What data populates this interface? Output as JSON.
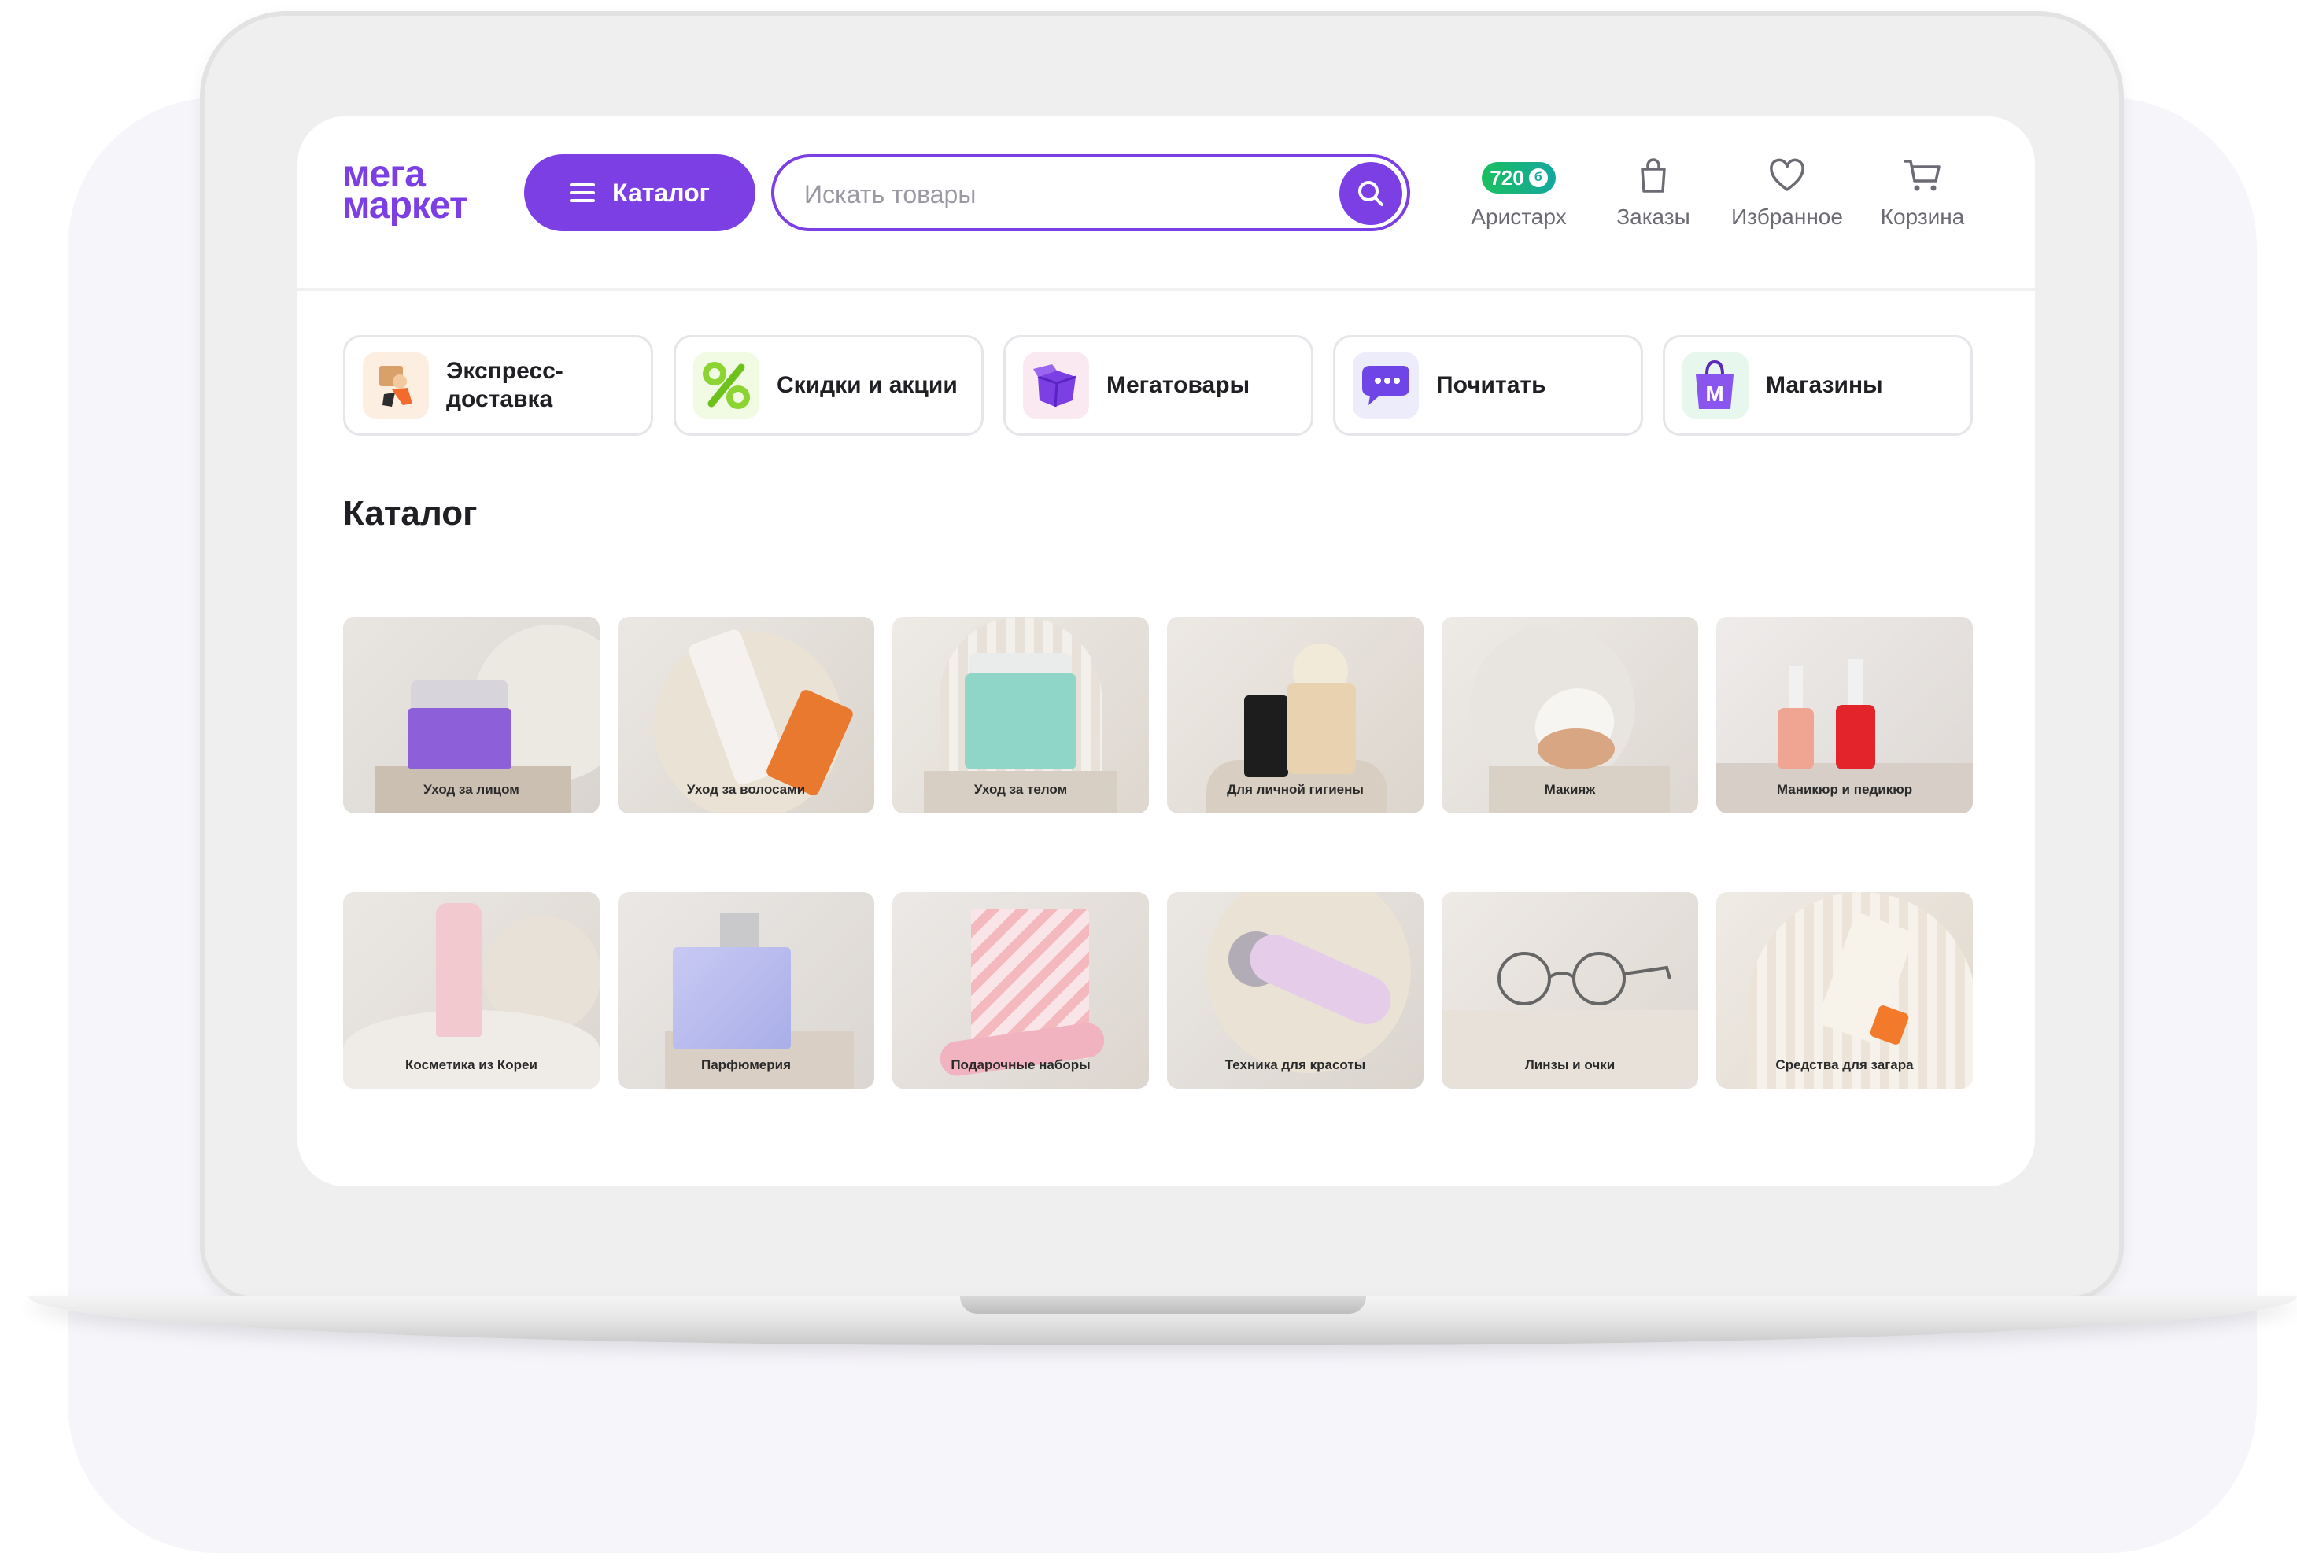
{
  "header": {
    "logo_line1": "мега",
    "logo_line2": "маркет",
    "catalog_label": "Каталог",
    "search_placeholder": "Искать товары",
    "bonus_value": "720",
    "user_label": "Аристарх",
    "orders_label": "Заказы",
    "favorites_label": "Избранное",
    "cart_label": "Корзина"
  },
  "quick_links": [
    {
      "label": "Экспресс-доставка",
      "icon": "delivery-courier-icon"
    },
    {
      "label": "Скидки и акции",
      "icon": "percent-icon"
    },
    {
      "label": "Мегатовары",
      "icon": "box-icon"
    },
    {
      "label": "Почитать",
      "icon": "chat-bubble-icon"
    },
    {
      "label": "Магазины",
      "icon": "shopping-bag-icon"
    }
  ],
  "catalog": {
    "title": "Каталог",
    "items": [
      {
        "label": "Уход за лицом"
      },
      {
        "label": "Уход за волосами"
      },
      {
        "label": "Уход за телом"
      },
      {
        "label": "Для личной гигиены"
      },
      {
        "label": "Макияж"
      },
      {
        "label": "Маникюр и педикюр"
      },
      {
        "label": "Косметика из Кореи"
      },
      {
        "label": "Парфюмерия"
      },
      {
        "label": "Подарочные наборы"
      },
      {
        "label": "Техника для красоты"
      },
      {
        "label": "Линзы и очки"
      },
      {
        "label": "Средства для загара"
      }
    ]
  },
  "colors": {
    "brand": "#7b3fe4",
    "bonus": "#1bbf5e"
  }
}
